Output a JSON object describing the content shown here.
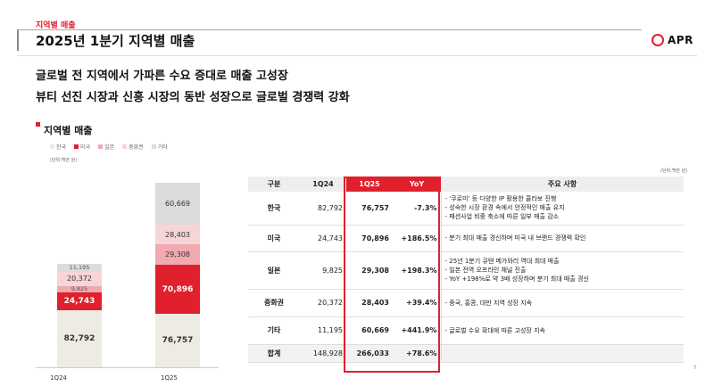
{
  "header": {
    "section_label": "지역별 매출",
    "title": "2025년 1분기 지역별 매출",
    "logo_text": "APR"
  },
  "headlines": [
    "글로벌 전 지역에서 가파른 수요 증대로 매출 고성장",
    "뷰티 선진 시장과 신흥 시장의 동반 성장으로 글로벌 경쟁력 강화"
  ],
  "chart": {
    "title": "지역별 매출",
    "unit": "(단위:백만 원)",
    "legend": [
      {
        "label": "한국",
        "color": "#eeebe3"
      },
      {
        "label": "미국",
        "color": "#e0202c"
      },
      {
        "label": "일본",
        "color": "#f2a9b0"
      },
      {
        "label": "중화권",
        "color": "#f7d4d8"
      },
      {
        "label": "기타",
        "color": "#dcdcdc"
      }
    ]
  },
  "chart_data": {
    "type": "bar",
    "stacked": true,
    "categories": [
      "1Q24",
      "1Q25"
    ],
    "series": [
      {
        "name": "한국",
        "values": [
          82792,
          76757
        ],
        "labels": [
          "82,792",
          "76,757"
        ]
      },
      {
        "name": "미국",
        "values": [
          24743,
          70896
        ],
        "labels": [
          "24,743",
          "70,896"
        ]
      },
      {
        "name": "일본",
        "values": [
          9825,
          29308
        ],
        "labels": [
          "9,825",
          "29,308"
        ]
      },
      {
        "name": "중화권",
        "values": [
          20372,
          28403
        ],
        "labels": [
          "20,372",
          "28,403"
        ]
      },
      {
        "name": "기타",
        "values": [
          11195,
          60669
        ],
        "labels": [
          "11,195",
          "60,669"
        ]
      }
    ],
    "ylim": [
      0,
      266033
    ]
  },
  "table": {
    "unit": "(단위:백만 원)",
    "headers": [
      "구분",
      "1Q24",
      "1Q25",
      "YoY",
      "주요 사항"
    ],
    "rows": [
      {
        "label": "한국",
        "q24": "82,792",
        "q25": "76,757",
        "yoy": "-7.3%",
        "notes": [
          "- '쿠로미' 등 다양한 IP 활용한 콜라보 진행",
          "- 성숙한 시장 환경 속에서 안정적인 매출 유지",
          "- 패션사업 비중 축소에 따른 일부 매출 감소"
        ]
      },
      {
        "label": "미국",
        "q24": "24,743",
        "q25": "70,896",
        "yoy": "+186.5%",
        "notes": [
          "- 분기 최대 매출 경신하며 미국 내 브랜드 경쟁력 확인"
        ]
      },
      {
        "label": "일본",
        "q24": "9,825",
        "q25": "29,308",
        "yoy": "+198.3%",
        "notes": [
          "- 25년 1분기 큐텐 메가와리 역대 최대 매출",
          "- 일본 전역 오프라인 채널 진출",
          "- YoY +198%로 약 3배 성장하며 분기 최대 매출 경신"
        ]
      },
      {
        "label": "중화권",
        "q24": "20,372",
        "q25": "28,403",
        "yoy": "+39.4%",
        "notes": [
          "- 중국, 홍콩, 대만 지역 성장 지속"
        ]
      },
      {
        "label": "기타",
        "q24": "11,195",
        "q25": "60,669",
        "yoy": "+441.9%",
        "notes": [
          "- 글로벌 수요 확대에 따른 고성장 지속"
        ]
      }
    ],
    "total": {
      "label": "합계",
      "q24": "148,928",
      "q25": "266,033",
      "yoy": "+78.6%"
    }
  },
  "page_number": "7"
}
